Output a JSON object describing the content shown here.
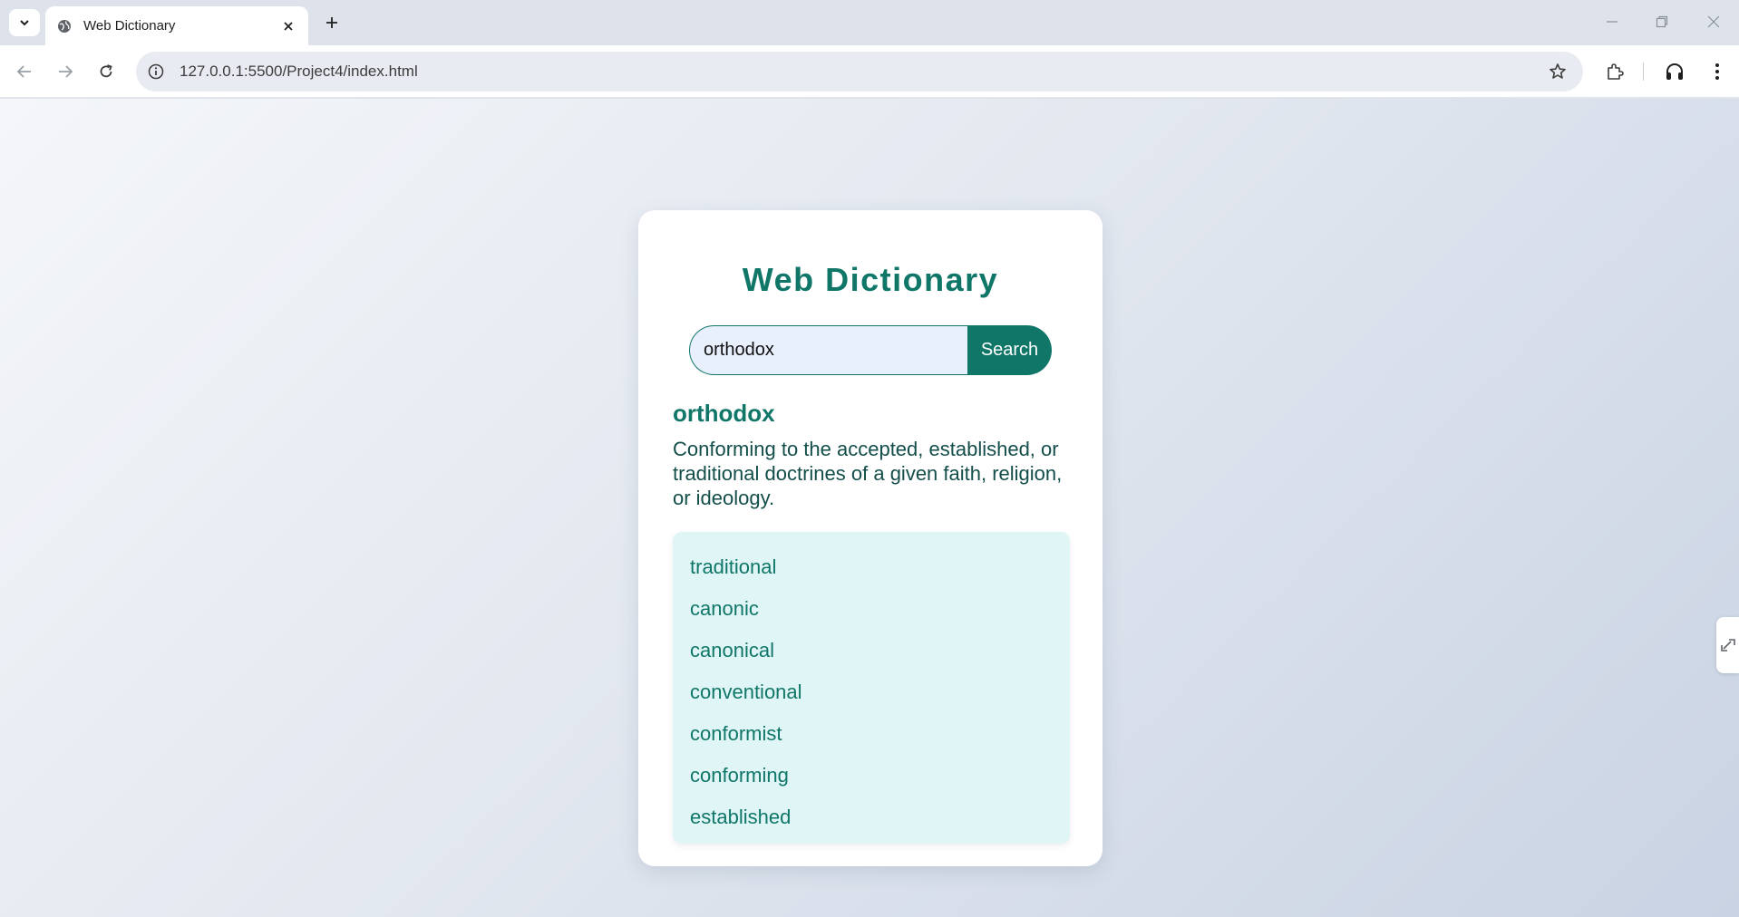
{
  "browser": {
    "tab_title": "Web Dictionary",
    "url": "127.0.0.1:5500/Project4/index.html"
  },
  "app": {
    "title": "Web Dictionary",
    "search": {
      "value": "orthodox",
      "button_label": "Search"
    },
    "result": {
      "word": "orthodox",
      "definition": "Conforming to the accepted, established, or traditional doctrines of a given faith, religion, or ideology.",
      "synonyms": [
        "traditional",
        "canonic",
        "canonical",
        "conventional",
        "conformist",
        "conforming",
        "established"
      ]
    }
  },
  "colors": {
    "accent": "#0f7668",
    "input_bg": "#e8effd",
    "synonym_bg": "#dff5f6"
  }
}
